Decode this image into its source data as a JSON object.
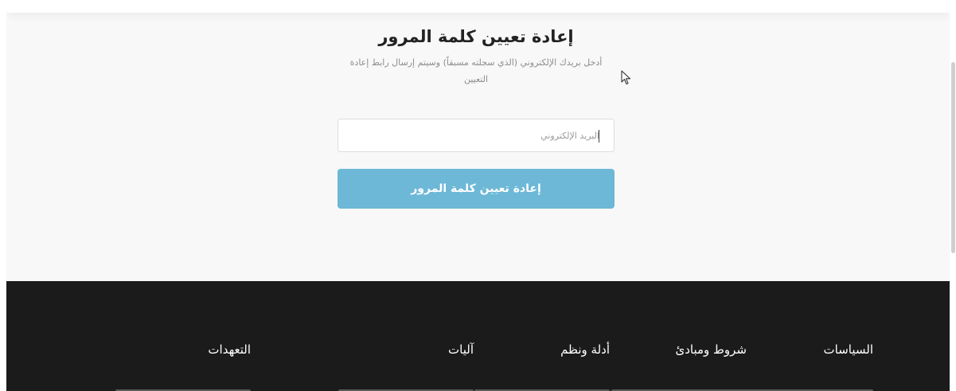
{
  "reset_form": {
    "title": "إعادة تعيين كلمة المرور",
    "subtitle": "أدخل بريدك الإلكتروني (الذي سجلته مسبقاً) وسيتم إرسال رابط إعادة التعيين",
    "email_placeholder": "البريد الإلكتروني",
    "email_value": "",
    "submit_label": "إعادة تعيين كلمة المرور"
  },
  "footer": {
    "columns": [
      {
        "label": "السياسات"
      },
      {
        "label": "شروط ومبادئ"
      },
      {
        "label": "أدلة ونظم"
      },
      {
        "label": "آليات"
      },
      {
        "label": "التعهدات"
      }
    ]
  },
  "colors": {
    "page_background": "#f8f8f8",
    "button": "#6db8d7",
    "footer_background": "#1b1b1b"
  },
  "icons": {
    "cursor": "mouse-pointer-icon"
  }
}
